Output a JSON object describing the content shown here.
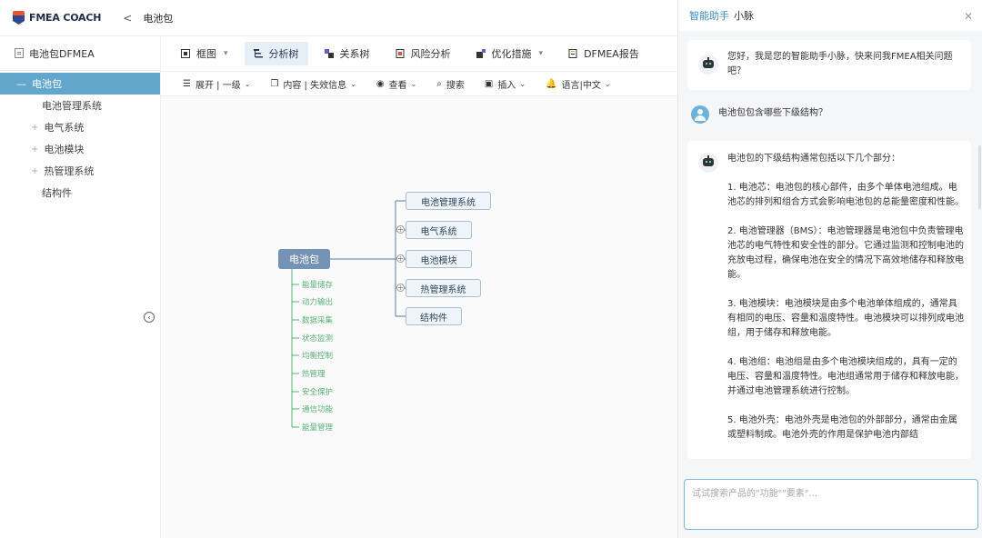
{
  "header": {
    "logo_text": "FMEA COACH",
    "back": "<",
    "title": "电池包"
  },
  "sidebar": {
    "root_label": "电池包DFMEA",
    "items": [
      {
        "label": "电池包",
        "prefix": "—"
      },
      {
        "label": "电池管理系统",
        "prefix": ""
      },
      {
        "label": "电气系统",
        "prefix": "+"
      },
      {
        "label": "电池模块",
        "prefix": "+"
      },
      {
        "label": "热管理系统",
        "prefix": "+"
      },
      {
        "label": "结构件",
        "prefix": ""
      }
    ],
    "collapse_symbol": "‹"
  },
  "toolbar1": {
    "items": [
      {
        "label": "框图",
        "caret": "▾"
      },
      {
        "label": "分析树",
        "caret": ""
      },
      {
        "label": "关系树",
        "caret": ""
      },
      {
        "label": "风险分析",
        "caret": ""
      },
      {
        "label": "优化措施",
        "caret": "▾"
      },
      {
        "label": "DFMEA报告",
        "caret": ""
      }
    ]
  },
  "toolbar2": {
    "items": [
      {
        "icon": "☰",
        "label": "展开 | 一级",
        "caret": "⌄"
      },
      {
        "icon": "❐",
        "label": "内容 | 失效信息",
        "caret": "⌄"
      },
      {
        "icon": "◉",
        "label": "查看",
        "caret": "⌄"
      },
      {
        "icon": "⌕",
        "label": "搜索",
        "caret": ""
      },
      {
        "icon": "▣",
        "label": "插入",
        "caret": "⌄"
      },
      {
        "icon": "🔔",
        "label": "语言|中文",
        "caret": "⌄"
      }
    ]
  },
  "mindmap": {
    "root": "电池包",
    "children": [
      "电池管理系统",
      "电气系统",
      "电池模块",
      "热管理系统",
      "结构件"
    ],
    "functions": [
      "能量储存",
      "动力输出",
      "数据采集",
      "状态监测",
      "均衡控制",
      "热管理",
      "安全保护",
      "通信功能",
      "能量管理"
    ],
    "plus": "+"
  },
  "assistant": {
    "title": "智能助手",
    "name": "小脉",
    "close": "✕",
    "greeting": "您好，我是您的智能助手小脉，快来问我FMEA相关问题吧？",
    "user_question": "电池包包含哪些下级结构？",
    "answer_intro": "电池包的下级结构通常包括以下几个部分：",
    "answer_points": [
      "1. 电池芯：电池包的核心部件，由多个单体电池组成。电池芯的排列和组合方式会影响电池包的总能量密度和性能。",
      "2. 电池管理器（BMS）：电池管理器是电池包中负责管理电池芯的电气特性和安全性的部分。它通过监测和控制电池的充放电过程，确保电池在安全的情况下高效地储存和释放电能。",
      "3. 电池模块：电池模块是由多个电池单体组成的，通常具有相同的电压、容量和温度特性。电池模块可以排列成电池组，用于储存和释放电能。",
      "4. 电池组：电池组是由多个电池模块组成的，具有一定的电压、容量和温度特性。电池组通常用于储存和释放电能，并通过电池管理系统进行控制。",
      "5. 电池外壳：电池外壳是电池包的外部部分，通常由金属或塑料制成。电池外壳的作用是保护电池内部结"
    ],
    "input_placeholder": "试试搜索产品的\"功能\"\"要素\"..."
  },
  "colors": {
    "accent": "#62a6cc",
    "node_root": "#7593b4",
    "function_green": "#5bb27a"
  }
}
